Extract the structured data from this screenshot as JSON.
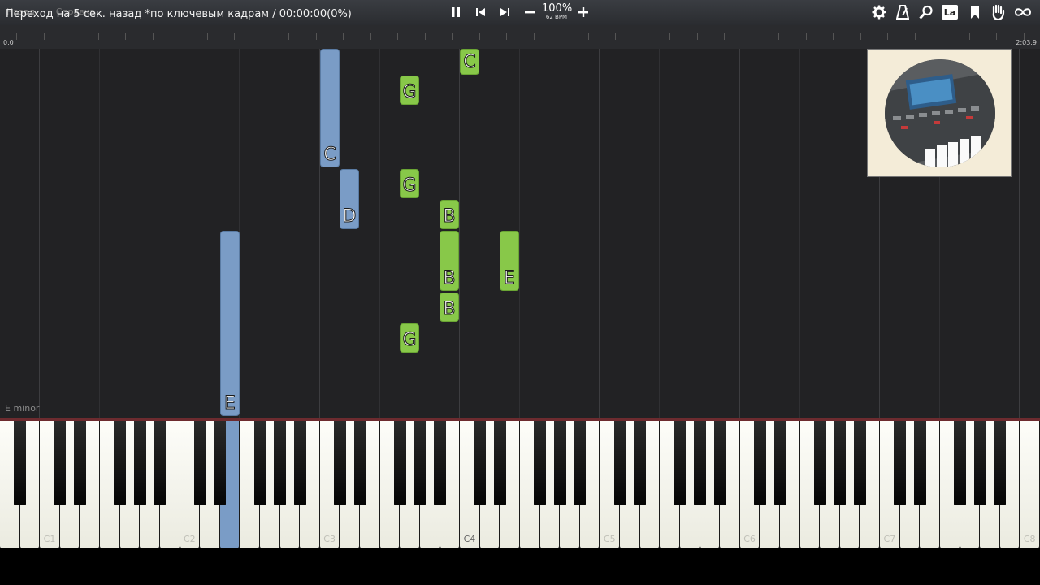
{
  "toolbar": {
    "ghost_menu": [
      "Назад",
      "Справка"
    ],
    "status": "Переход на 5 сек. назад *по ключевым кадрам / 00:00:00(0%)",
    "zoom": "100%",
    "bpm": "62 BPM",
    "icons": [
      "pause-icon",
      "skip-back-icon",
      "skip-forward-icon",
      "minus-icon",
      "plus-icon",
      "gear-icon",
      "metronome-icon",
      "search-icon",
      "label-icon",
      "bookmark-icon",
      "hand-icon",
      "loop-icon"
    ],
    "label_icon_text": "La"
  },
  "timeline": {
    "start": "0.0",
    "end": "2:03.9"
  },
  "key_signature": "E minor",
  "notes": [
    {
      "label": "C",
      "hand": "left"
    },
    {
      "label": "D",
      "hand": "left"
    },
    {
      "label": "E",
      "hand": "left"
    },
    {
      "label": "C",
      "hand": "right"
    },
    {
      "label": "G",
      "hand": "right"
    },
    {
      "label": "G",
      "hand": "right"
    },
    {
      "label": "B",
      "hand": "right"
    },
    {
      "label": "B",
      "hand": "right"
    },
    {
      "label": "E",
      "hand": "right"
    },
    {
      "label": "B",
      "hand": "right"
    },
    {
      "label": "G",
      "hand": "right"
    }
  ],
  "keyboard": {
    "octave_labels": [
      "C1",
      "C2",
      "C3",
      "C4",
      "C5",
      "C6",
      "C7",
      "C8"
    ],
    "pressed_key": "E2"
  },
  "colors": {
    "left_hand": "#7a9cc6",
    "right_hand": "#88c849"
  }
}
